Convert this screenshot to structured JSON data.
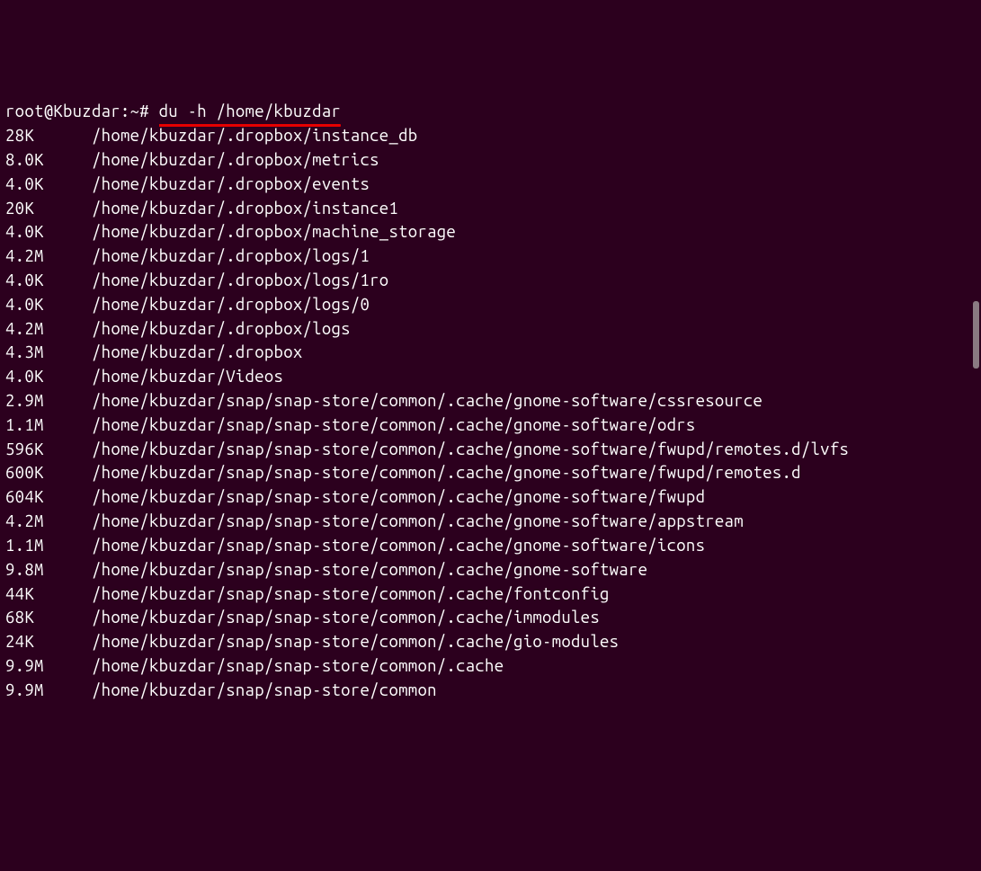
{
  "prompt": {
    "user_host": "root@Kbuzdar",
    "cwd": "~",
    "separator1": ":",
    "separator2": "#",
    "command": "du -h /home/kbuzdar"
  },
  "output": [
    {
      "size": "28K",
      "path": "/home/kbuzdar/.dropbox/instance_db"
    },
    {
      "size": "8.0K",
      "path": "/home/kbuzdar/.dropbox/metrics"
    },
    {
      "size": "4.0K",
      "path": "/home/kbuzdar/.dropbox/events"
    },
    {
      "size": "20K",
      "path": "/home/kbuzdar/.dropbox/instance1"
    },
    {
      "size": "4.0K",
      "path": "/home/kbuzdar/.dropbox/machine_storage"
    },
    {
      "size": "4.2M",
      "path": "/home/kbuzdar/.dropbox/logs/1"
    },
    {
      "size": "4.0K",
      "path": "/home/kbuzdar/.dropbox/logs/1ro"
    },
    {
      "size": "4.0K",
      "path": "/home/kbuzdar/.dropbox/logs/0"
    },
    {
      "size": "4.2M",
      "path": "/home/kbuzdar/.dropbox/logs"
    },
    {
      "size": "4.3M",
      "path": "/home/kbuzdar/.dropbox"
    },
    {
      "size": "4.0K",
      "path": "/home/kbuzdar/Videos"
    },
    {
      "size": "2.9M",
      "path": "/home/kbuzdar/snap/snap-store/common/.cache/gnome-software/cssresource"
    },
    {
      "size": "1.1M",
      "path": "/home/kbuzdar/snap/snap-store/common/.cache/gnome-software/odrs"
    },
    {
      "size": "596K",
      "path": "/home/kbuzdar/snap/snap-store/common/.cache/gnome-software/fwupd/remotes.d/lvfs"
    },
    {
      "size": "600K",
      "path": "/home/kbuzdar/snap/snap-store/common/.cache/gnome-software/fwupd/remotes.d"
    },
    {
      "size": "604K",
      "path": "/home/kbuzdar/snap/snap-store/common/.cache/gnome-software/fwupd"
    },
    {
      "size": "4.2M",
      "path": "/home/kbuzdar/snap/snap-store/common/.cache/gnome-software/appstream"
    },
    {
      "size": "1.1M",
      "path": "/home/kbuzdar/snap/snap-store/common/.cache/gnome-software/icons"
    },
    {
      "size": "9.8M",
      "path": "/home/kbuzdar/snap/snap-store/common/.cache/gnome-software"
    },
    {
      "size": "44K",
      "path": "/home/kbuzdar/snap/snap-store/common/.cache/fontconfig"
    },
    {
      "size": "68K",
      "path": "/home/kbuzdar/snap/snap-store/common/.cache/immodules"
    },
    {
      "size": "24K",
      "path": "/home/kbuzdar/snap/snap-store/common/.cache/gio-modules"
    },
    {
      "size": "9.9M",
      "path": "/home/kbuzdar/snap/snap-store/common/.cache"
    },
    {
      "size": "9.9M",
      "path": "/home/kbuzdar/snap/snap-store/common"
    }
  ]
}
